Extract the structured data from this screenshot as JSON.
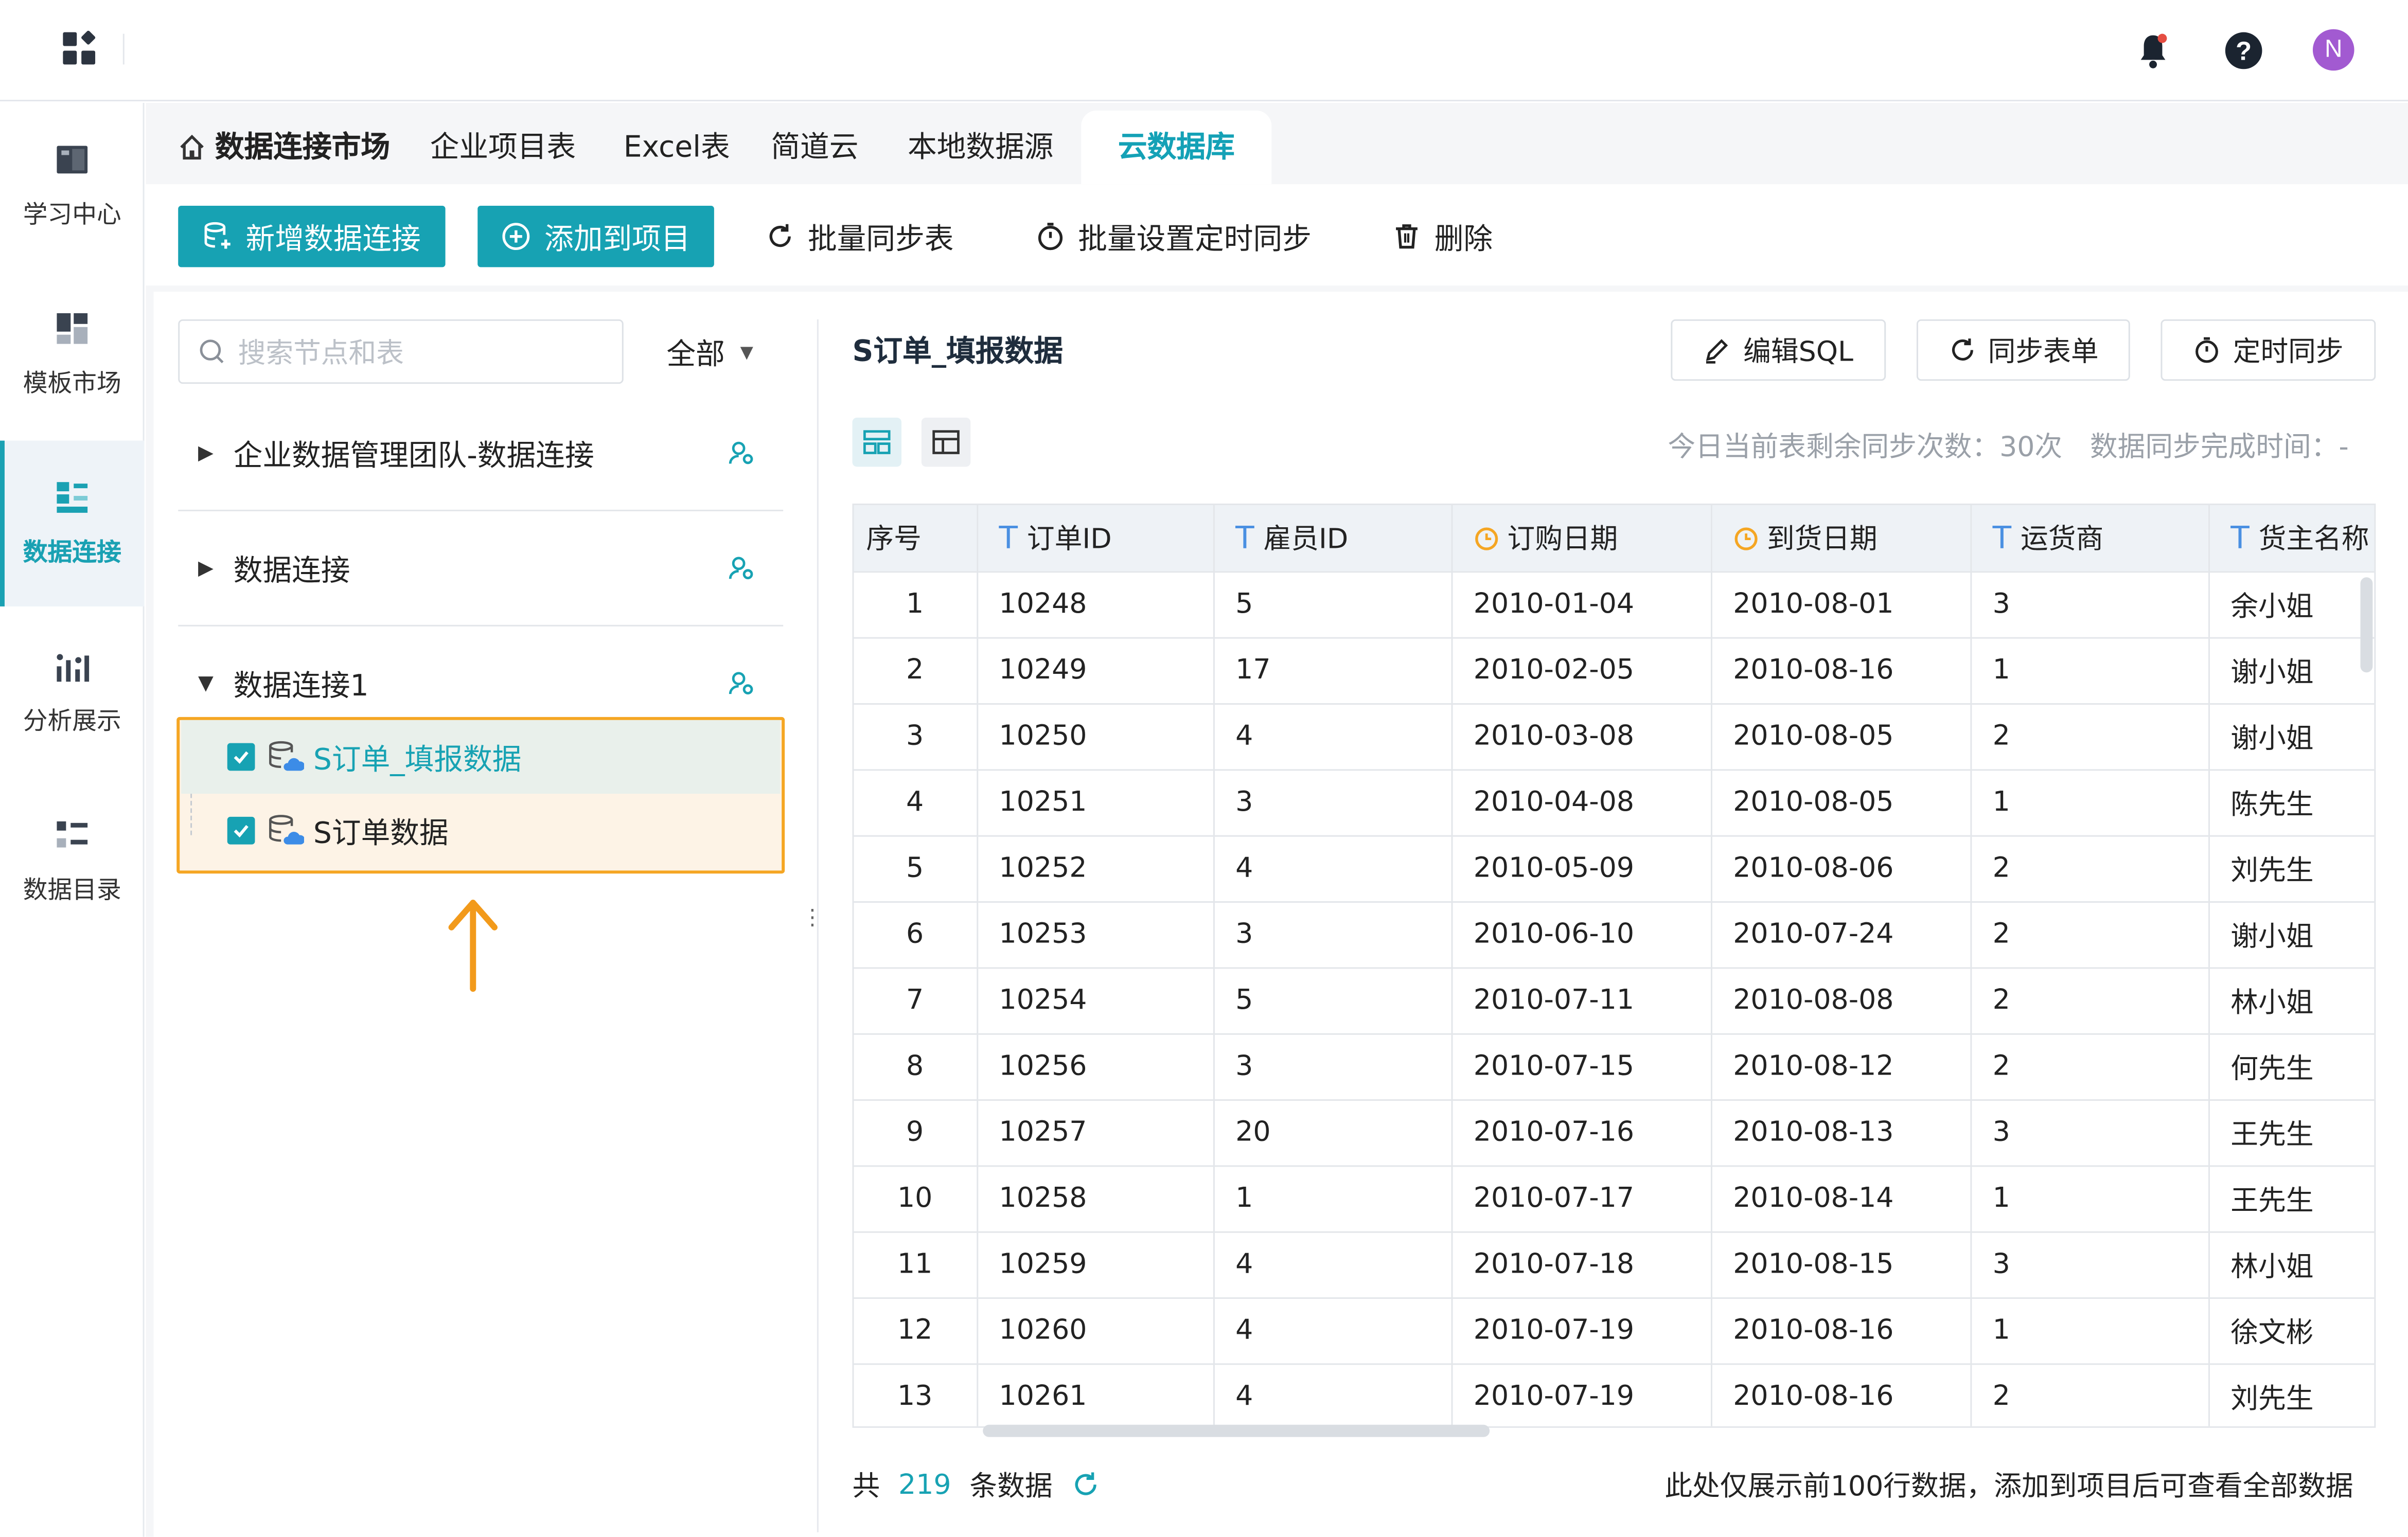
{
  "nav": {
    "items": [
      {
        "label": "学习中心",
        "icon": "book-icon"
      },
      {
        "label": "模板市场",
        "icon": "template-icon"
      },
      {
        "label": "数据连接",
        "icon": "data-connection-icon"
      },
      {
        "label": "分析展示",
        "icon": "chart-icon"
      },
      {
        "label": "数据目录",
        "icon": "catalog-icon"
      }
    ],
    "active_index": 2
  },
  "header": {
    "avatar_letter": "N",
    "avatar_color": "#a25ad1"
  },
  "tabs": {
    "market": "数据连接市场",
    "items": [
      "企业项目表",
      "Excel表",
      "简道云",
      "本地数据源",
      "云数据库"
    ]
  },
  "toolbar": {
    "add_connection": "新增数据连接",
    "add_to_project": "添加到项目",
    "batch_sync": "批量同步表",
    "batch_schedule": "批量设置定时同步",
    "delete": "删除"
  },
  "tree": {
    "search_placeholder": "搜索节点和表",
    "filter": "全部",
    "groups": [
      "企业数据管理团队-数据连接",
      "数据连接",
      "数据连接1"
    ],
    "leaves": [
      "S订单_填报数据",
      "S订单数据"
    ]
  },
  "detail": {
    "title": "S订单_填报数据",
    "edit_sql": "编辑SQL",
    "sync_form": "同步表单",
    "schedule_sync": "定时同步",
    "sync_info": "今日当前表剩余同步次数：30次　数据同步完成时间：-",
    "columns": [
      "序号",
      "订单ID",
      "雇员ID",
      "订购日期",
      "到货日期",
      "运货商",
      "货主名称"
    ],
    "rows": [
      [
        "1",
        "10248",
        "5",
        "2010-01-04",
        "2010-08-01",
        "3",
        "余小姐"
      ],
      [
        "2",
        "10249",
        "17",
        "2010-02-05",
        "2010-08-16",
        "1",
        "谢小姐"
      ],
      [
        "3",
        "10250",
        "4",
        "2010-03-08",
        "2010-08-05",
        "2",
        "谢小姐"
      ],
      [
        "4",
        "10251",
        "3",
        "2010-04-08",
        "2010-08-05",
        "1",
        "陈先生"
      ],
      [
        "5",
        "10252",
        "4",
        "2010-05-09",
        "2010-08-06",
        "2",
        "刘先生"
      ],
      [
        "6",
        "10253",
        "3",
        "2010-06-10",
        "2010-07-24",
        "2",
        "谢小姐"
      ],
      [
        "7",
        "10254",
        "5",
        "2010-07-11",
        "2010-08-08",
        "2",
        "林小姐"
      ],
      [
        "8",
        "10256",
        "3",
        "2010-07-15",
        "2010-08-12",
        "2",
        "何先生"
      ],
      [
        "9",
        "10257",
        "20",
        "2010-07-16",
        "2010-08-13",
        "3",
        "王先生"
      ],
      [
        "10",
        "10258",
        "1",
        "2010-07-17",
        "2010-08-14",
        "1",
        "王先生"
      ],
      [
        "11",
        "10259",
        "4",
        "2010-07-18",
        "2010-08-15",
        "3",
        "林小姐"
      ],
      [
        "12",
        "10260",
        "4",
        "2010-07-19",
        "2010-08-16",
        "1",
        "徐文彬"
      ],
      [
        "13",
        "10261",
        "4",
        "2010-07-19",
        "2010-08-16",
        "2",
        "刘先生"
      ]
    ],
    "footer_prefix": "共",
    "total": "219",
    "footer_suffix": "条数据",
    "footer_note": "此处仅展示前100行数据，添加到项目后可查看全部数据"
  },
  "colors": {
    "accent": "#17a2b3",
    "highlight_border": "#f5a623",
    "arrow": "#f29a1b"
  }
}
